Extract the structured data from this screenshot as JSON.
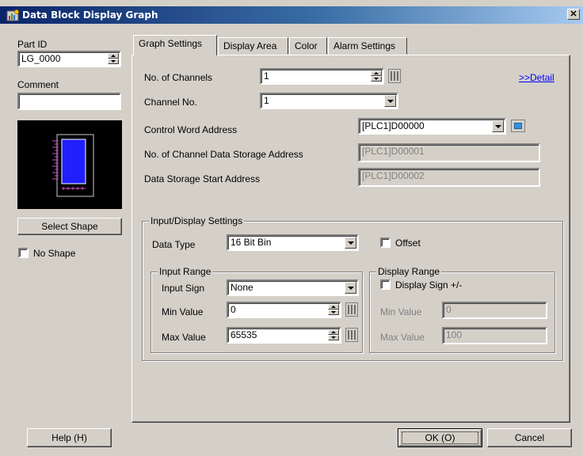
{
  "window": {
    "title": "Data Block Display Graph",
    "close_label": "✕"
  },
  "left": {
    "part_id_label": "Part ID",
    "part_id_value": "LG_0000",
    "comment_label": "Comment",
    "comment_value": "",
    "select_shape_label": "Select Shape",
    "no_shape_label": "No Shape",
    "no_shape_checked": false
  },
  "tabs": [
    {
      "label": "Graph Settings",
      "active": true
    },
    {
      "label": "Display Area",
      "active": false
    },
    {
      "label": "Color",
      "active": false
    },
    {
      "label": "Alarm Settings",
      "active": false
    }
  ],
  "graph": {
    "channels_label": "No. of Channels",
    "channels_value": "1",
    "detail_link": ">>Detail",
    "channel_no_label": "Channel No.",
    "channel_no_value": "1",
    "control_word_label": "Control Word Address",
    "control_word_value": "[PLC1]D00000",
    "data_storage_count_label": "No. of Channel Data Storage Address",
    "data_storage_count_value": "[PLC1]D00001",
    "data_storage_start_label": "Data Storage Start Address",
    "data_storage_start_value": "[PLC1]D00002"
  },
  "io": {
    "group_label": "Input/Display Settings",
    "data_type_label": "Data Type",
    "data_type_value": "16 Bit Bin",
    "offset_label": "Offset",
    "offset_checked": false,
    "input_range": {
      "label": "Input Range",
      "sign_label": "Input Sign",
      "sign_value": "None",
      "min_label": "Min Value",
      "min_value": "0",
      "max_label": "Max Value",
      "max_value": "65535"
    },
    "display_range": {
      "label": "Display Range",
      "sign_label": "Display Sign +/-",
      "sign_checked": false,
      "min_label": "Min Value",
      "min_value": "0",
      "max_label": "Max Value",
      "max_value": "100"
    }
  },
  "footer": {
    "help_label": "Help (H)",
    "ok_label": "OK (O)",
    "cancel_label": "Cancel"
  }
}
